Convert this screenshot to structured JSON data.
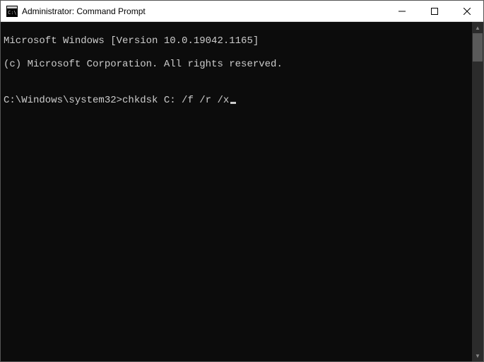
{
  "window": {
    "title": "Administrator: Command Prompt"
  },
  "console": {
    "line1": "Microsoft Windows [Version 10.0.19042.1165]",
    "line2": "(c) Microsoft Corporation. All rights reserved.",
    "blank": "",
    "prompt": "C:\\Windows\\system32>",
    "command": "chkdsk C: /f /r /x"
  }
}
